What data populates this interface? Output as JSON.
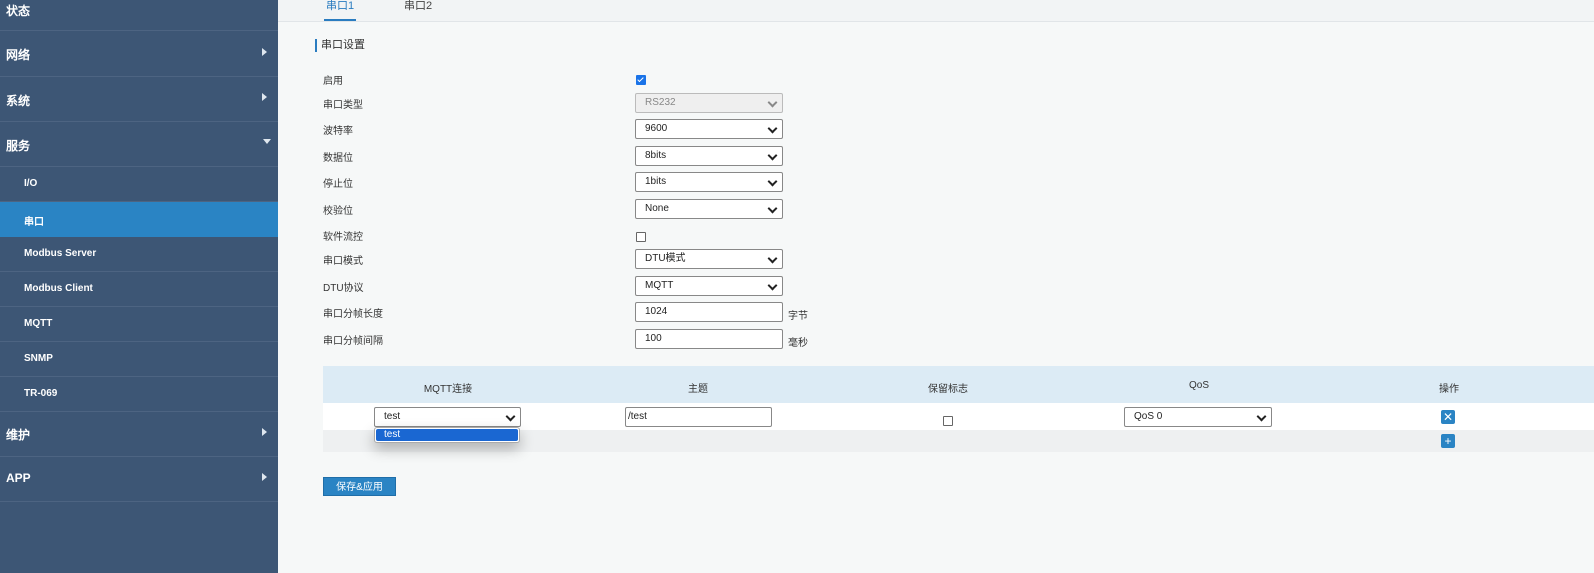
{
  "sidebar": {
    "items": [
      {
        "label": "状态"
      },
      {
        "label": "网络"
      },
      {
        "label": "系统"
      },
      {
        "label": "服务"
      },
      {
        "label": "I/O"
      },
      {
        "label": "串口"
      },
      {
        "label": "Modbus Server"
      },
      {
        "label": "Modbus Client"
      },
      {
        "label": "MQTT"
      },
      {
        "label": "SNMP"
      },
      {
        "label": "TR-069"
      },
      {
        "label": "维护"
      },
      {
        "label": "APP"
      }
    ]
  },
  "tabs": [
    "串口1",
    "串口2"
  ],
  "section_title": "串口设置",
  "form": {
    "enable_label": "启用",
    "enable_checked": true,
    "serial_type_label": "串口类型",
    "serial_type_value": "RS232",
    "baud_label": "波特率",
    "baud_value": "9600",
    "data_bits_label": "数据位",
    "data_bits_value": "8bits",
    "stop_bits_label": "停止位",
    "stop_bits_value": "1bits",
    "parity_label": "校验位",
    "parity_value": "None",
    "flow_label": "软件流控",
    "flow_checked": false,
    "mode_label": "串口模式",
    "mode_value": "DTU模式",
    "protocol_label": "DTU协议",
    "protocol_value": "MQTT",
    "frame_len_label": "串口分帧长度",
    "frame_len_value": "1024",
    "frame_len_unit": "字节",
    "frame_interval_label": "串口分帧间隔",
    "frame_interval_value": "100",
    "frame_interval_unit": "毫秒"
  },
  "table": {
    "headers": [
      "MQTT连接",
      "主题",
      "保留标志",
      "QoS",
      "操作"
    ],
    "row": {
      "connection": "test",
      "topic": "/test",
      "retain": false,
      "qos": "QoS 0"
    },
    "dropdown_options": [
      "test"
    ]
  },
  "save_label": "保存&应用",
  "colors": {
    "sidebar_bg": "#3d5675",
    "accent": "#2a84c4",
    "table_header_bg": "#dcebf5"
  }
}
